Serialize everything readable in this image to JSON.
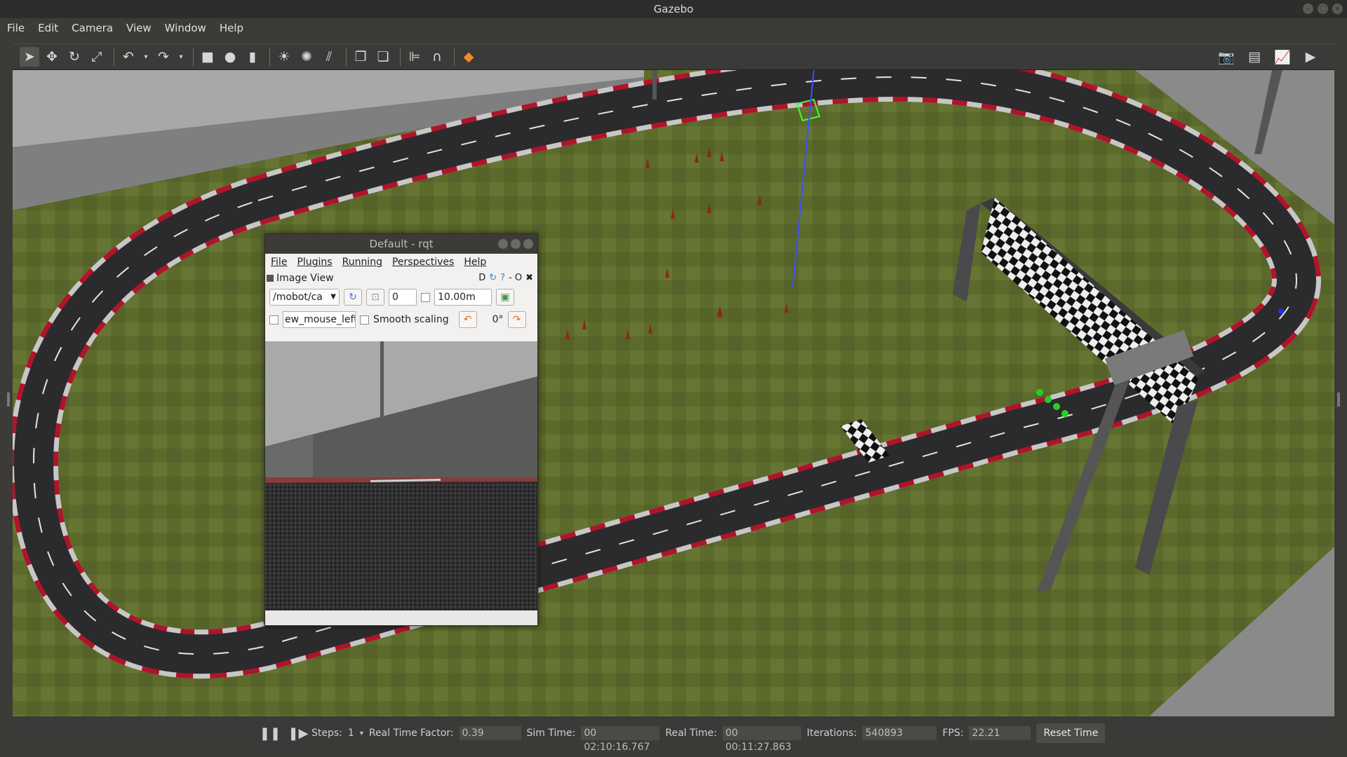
{
  "window": {
    "title": "Gazebo"
  },
  "menubar": {
    "items": [
      "File",
      "Edit",
      "Camera",
      "View",
      "Window",
      "Help"
    ]
  },
  "toolbar": {
    "tools": [
      "select-icon",
      "translate-icon",
      "rotate-icon",
      "scale-icon",
      "undo-icon",
      "redo-icon",
      "box-icon",
      "sphere-icon",
      "cylinder-icon",
      "point-light-icon",
      "spot-light-icon",
      "directional-light-icon",
      "copy-icon",
      "paste-icon",
      "align-icon",
      "snap-icon",
      "view-angle-icon"
    ],
    "right_tools": [
      "screenshot-icon",
      "log-icon",
      "plot-icon",
      "record-icon"
    ]
  },
  "rqt": {
    "title": "Default - rqt",
    "menu": [
      "File",
      "Plugins",
      "Running",
      "Perspectives",
      "Help"
    ],
    "plugin_title": "Image View",
    "plugin_ctrls": "D",
    "plugin_ctrls2": "- O",
    "topic": "/mobot/ca",
    "spin_value": "0",
    "max_range": "10.00m",
    "mouse_topic": "ew_mouse_left",
    "smooth_label": "Smooth scaling",
    "rotation": "0°"
  },
  "status": {
    "steps_label": "Steps:",
    "steps_value": "1",
    "rtf_label": "Real Time Factor:",
    "rtf_value": "0.39",
    "sim_time_label": "Sim Time:",
    "sim_time_value": "00 02:10:16.767",
    "real_time_label": "Real Time:",
    "real_time_value": "00 00:11:27.863",
    "iterations_label": "Iterations:",
    "iterations_value": "540893",
    "fps_label": "FPS:",
    "fps_value": "22.21",
    "reset_label": "Reset Time"
  },
  "colors": {
    "grass": "#5f6a2c",
    "track": "#2b2b2c",
    "curb_red": "#b0142a",
    "curb_white": "#d8d8d8",
    "wall": "#9a9a9a"
  }
}
